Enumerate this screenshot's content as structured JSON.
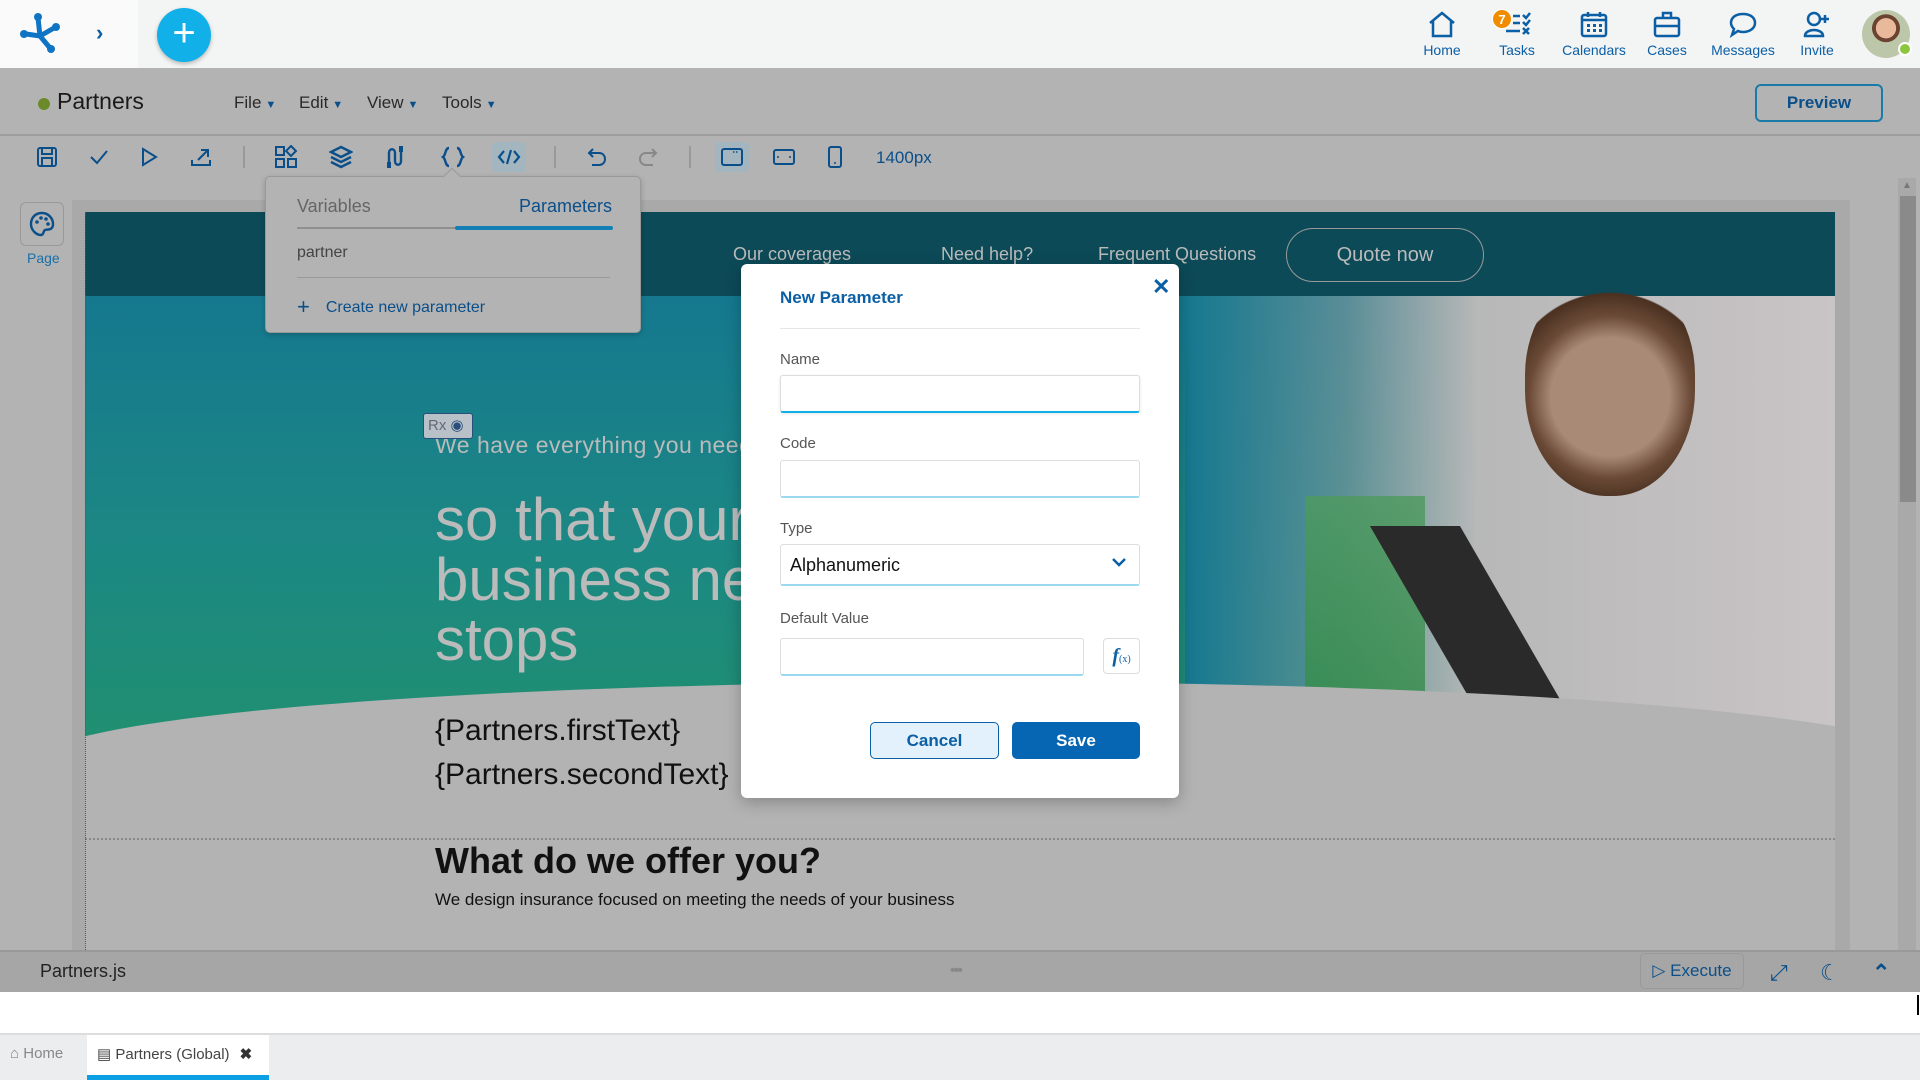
{
  "topbar": {
    "nav": [
      {
        "label": "Home",
        "icon": "home-icon"
      },
      {
        "label": "Tasks",
        "icon": "tasks-icon",
        "badge": "7"
      },
      {
        "label": "Calendars",
        "icon": "calendar-icon"
      },
      {
        "label": "Cases",
        "icon": "briefcase-icon"
      },
      {
        "label": "Messages",
        "icon": "chat-icon"
      },
      {
        "label": "Invite",
        "icon": "add-user-icon"
      }
    ],
    "expand_glyph": "›",
    "fab_glyph": "+"
  },
  "editor": {
    "title": "Partners",
    "status_color": "#6d8a2a",
    "menus": [
      "File",
      "Edit",
      "View",
      "Tools"
    ],
    "preview_label": "Preview",
    "zoom_value": "1400px"
  },
  "left_panel": {
    "page_label": "Page"
  },
  "popover": {
    "tabs": [
      "Variables",
      "Parameters"
    ],
    "active_tab": "Parameters",
    "items": [
      "partner"
    ],
    "create_label": "Create new parameter"
  },
  "canvas": {
    "nav": [
      "Our coverages",
      "Need help?",
      "Frequent Questions"
    ],
    "quote_label": "Quote now",
    "rx_label": "Rx",
    "hero_small": "We have everything you need",
    "hero_big": "so that your business never stops",
    "param_texts": [
      "{Partners.firstText}",
      "{Partners.secondText}"
    ],
    "offer_title": "What do we offer you?",
    "offer_subtitle": "We design insurance focused on meeting the needs of your business"
  },
  "modal": {
    "title": "New Parameter",
    "fields": {
      "name_label": "Name",
      "name_value": "",
      "code_label": "Code",
      "code_value": "",
      "type_label": "Type",
      "type_value": "Alphanumeric",
      "default_label": "Default Value",
      "default_value": ""
    },
    "fx_label": "f",
    "fx_sub": "(x)",
    "cancel_label": "Cancel",
    "save_label": "Save",
    "close_glyph": "✕"
  },
  "script_panel": {
    "file_name": "Partners.js",
    "execute_label": "Execute",
    "drag_glyph": "•••"
  },
  "bottom_tabs": [
    {
      "label": "Home",
      "icon": "home-icon"
    },
    {
      "label": "Partners (Global)",
      "icon": "form-icon",
      "active": true,
      "close_glyph": "✖"
    }
  ],
  "colors": {
    "brand_blue": "#0b5fa5",
    "accent_cyan": "#12b0e8",
    "badge_orange": "#f08c00",
    "save_blue": "#0766b3"
  }
}
